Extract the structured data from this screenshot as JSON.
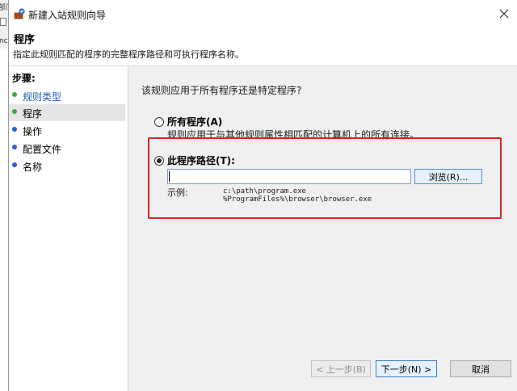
{
  "background": {
    "frag_top": "部门属性",
    "frag_side": "nc"
  },
  "window": {
    "title": "新建入站规则向导",
    "icon": "firewall-wizard-icon"
  },
  "header": {
    "title": "程序",
    "description": "指定此规则匹配的程序的完整程序路径和可执行程序名称。"
  },
  "steps": {
    "heading": "步骤:",
    "items": [
      {
        "label": "规则类型",
        "color": "#1b5fb5",
        "bullet": "#3aa842"
      },
      {
        "label": "程序",
        "color": "#000000",
        "bullet": "#3aa842"
      },
      {
        "label": "操作",
        "color": "#000000",
        "bullet": "#2a62c9"
      },
      {
        "label": "配置文件",
        "color": "#000000",
        "bullet": "#2a62c9"
      },
      {
        "label": "名称",
        "color": "#000000",
        "bullet": "#2a62c9"
      }
    ]
  },
  "content": {
    "question": "该规则应用于所有程序还是特定程序?",
    "all_programs": {
      "label": "所有程序(A)",
      "description": "规则应用于与其他规则属性相匹配的计算机上的所有连接。"
    },
    "this_program": {
      "label": "此程序路径(T):",
      "value": "",
      "browse_label": "浏览(R)...",
      "example_label": "示例:",
      "example_paths": [
        "c:\\path\\program.exe",
        "%ProgramFiles%\\browser\\browser.exe"
      ]
    }
  },
  "buttons": {
    "back": "< 上一步(B)",
    "next": "下一步(N) >",
    "cancel": "取消"
  },
  "colors": {
    "highlight": "#e02020",
    "accent": "#0078d7"
  }
}
